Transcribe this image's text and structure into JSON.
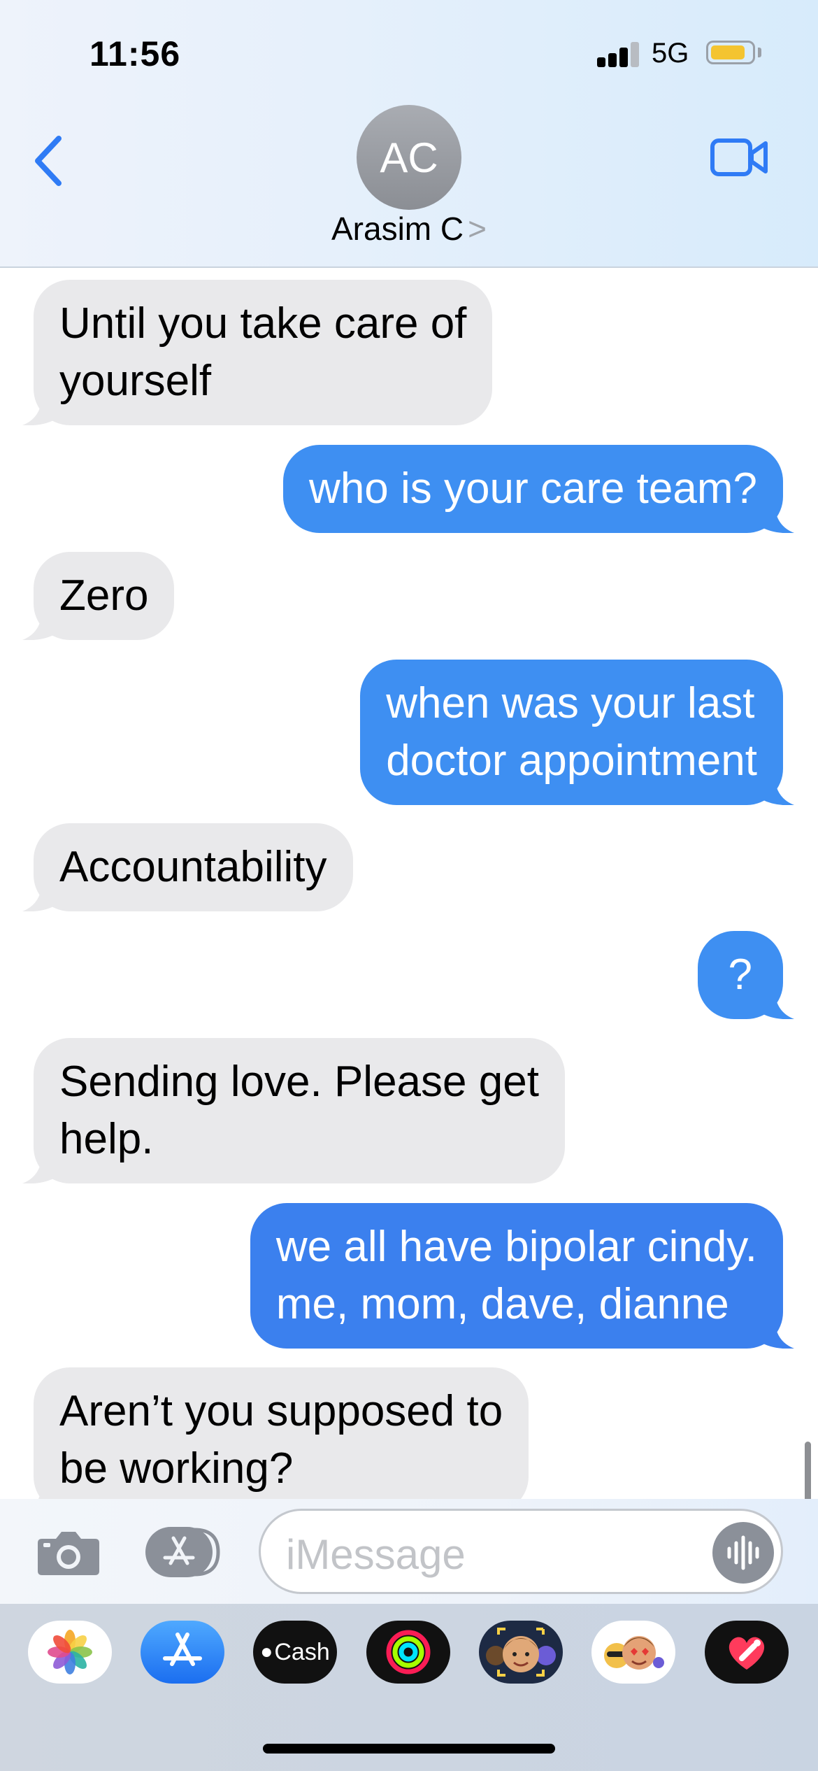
{
  "status_bar": {
    "time": "11:56",
    "network": "5G",
    "battery_percent": 85
  },
  "header": {
    "back_icon": "chevron-left-icon",
    "avatar_initials": "AC",
    "contact_name": "Arasim C",
    "contact_chevron": ">",
    "video_icon": "video-camera-icon",
    "accent_color": "#2f7bf5"
  },
  "messages": [
    {
      "direction": "incoming",
      "lines": [
        "Until you take care of",
        "yourself"
      ]
    },
    {
      "direction": "outgoing",
      "lines": [
        "who is your care team?"
      ]
    },
    {
      "direction": "incoming",
      "lines": [
        "Zero"
      ]
    },
    {
      "direction": "outgoing",
      "lines": [
        "when was your last",
        "doctor appointment"
      ]
    },
    {
      "direction": "incoming",
      "lines": [
        "Accountability"
      ]
    },
    {
      "direction": "outgoing",
      "lines": [
        "?"
      ]
    },
    {
      "direction": "incoming",
      "lines": [
        "Sending love.  Please get",
        "help."
      ]
    },
    {
      "direction": "outgoing",
      "lines": [
        "we all have bipolar cindy.",
        "me, mom, dave, dianne"
      ]
    },
    {
      "direction": "incoming",
      "lines": [
        "Aren’t you supposed to",
        "be working?"
      ]
    }
  ],
  "compose": {
    "camera_icon": "camera-icon",
    "apps_icon": "app-store-icon",
    "placeholder": "iMessage",
    "audio_icon": "audio-waveform-icon"
  },
  "app_drawer": [
    {
      "name": "photos",
      "icon": "photos-icon"
    },
    {
      "name": "app-store",
      "icon": "app-store-icon"
    },
    {
      "name": "cash",
      "label": "Cash",
      "icon": "apple-cash-icon"
    },
    {
      "name": "activity",
      "icon": "activity-rings-icon"
    },
    {
      "name": "memoji",
      "icon": "memoji-icon"
    },
    {
      "name": "memoji-stickers",
      "icon": "memoji-stickers-icon"
    },
    {
      "name": "digital-touch",
      "icon": "digital-touch-heart-icon"
    }
  ],
  "colors": {
    "incoming_bubble": "#e9e9eb",
    "outgoing_bubble": "#3e8ff2",
    "accent": "#2f7bf5"
  }
}
